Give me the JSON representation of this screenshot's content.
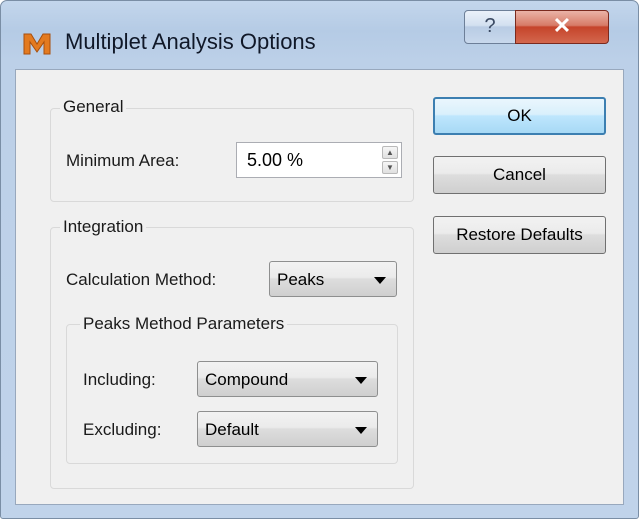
{
  "window": {
    "title": "Multiplet Analysis Options",
    "help_glyph": "?",
    "close_glyph": "✕"
  },
  "general": {
    "group_label": "General",
    "minimum_area_label": "Minimum Area:",
    "minimum_area_value": "5.00 %",
    "spin_up_glyph": "▲",
    "spin_down_glyph": "▼"
  },
  "integration": {
    "group_label": "Integration",
    "calculation_method_label": "Calculation Method:",
    "calculation_method_value": "Peaks",
    "peaks_params": {
      "group_label": "Peaks Method Parameters",
      "including_label": "Including:",
      "including_value": "Compound",
      "excluding_label": "Excluding:",
      "excluding_value": "Default"
    }
  },
  "buttons": {
    "ok": "OK",
    "cancel": "Cancel",
    "restore_defaults": "Restore Defaults"
  },
  "icons": {
    "app": "mnova-app-icon",
    "help": "help-icon",
    "close": "close-icon",
    "spin_up": "spin-up-icon",
    "spin_down": "spin-down-icon",
    "dropdown": "chevron-down-icon"
  },
  "colors": {
    "client_bg": "#f0f0f0",
    "close_button": "#c5442b",
    "default_button_border": "#3c7fb1",
    "app_icon_orange": "#e37a1f"
  }
}
